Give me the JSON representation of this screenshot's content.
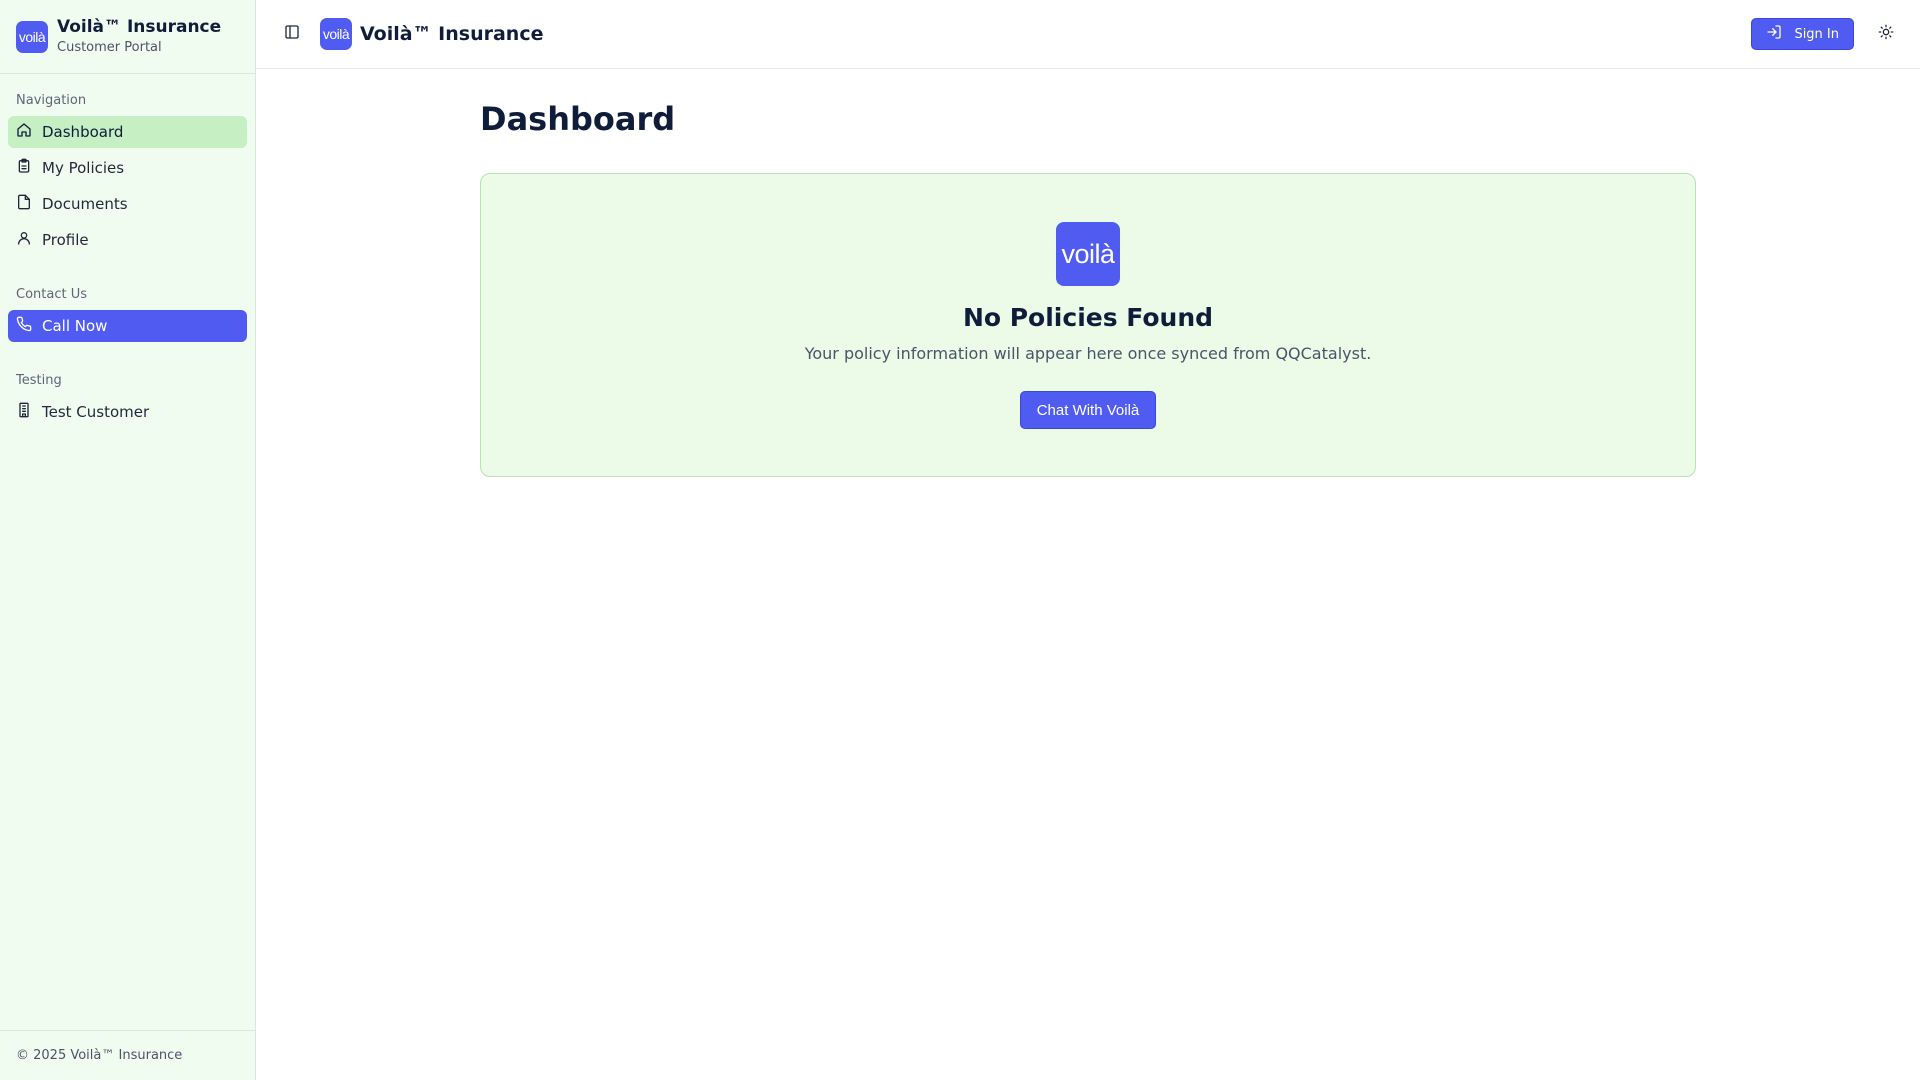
{
  "brand": {
    "logo_text": "voilà",
    "name": "Voilà™ Insurance",
    "subtitle": "Customer Portal",
    "color": "#4f5bf1"
  },
  "sidebar": {
    "groups": [
      {
        "label": "Navigation",
        "items": [
          {
            "label": "Dashboard",
            "icon": "home-icon",
            "active": true
          },
          {
            "label": "My Policies",
            "icon": "clipboard-icon"
          },
          {
            "label": "Documents",
            "icon": "file-icon"
          },
          {
            "label": "Profile",
            "icon": "user-icon"
          }
        ]
      },
      {
        "label": "Contact Us",
        "items": [
          {
            "label": "Call Now",
            "icon": "phone-icon",
            "primary": true
          }
        ]
      },
      {
        "label": "Testing",
        "items": [
          {
            "label": "Test Customer",
            "icon": "building-icon"
          }
        ]
      }
    ],
    "footer": "© 2025 Voilà™ Insurance"
  },
  "topbar": {
    "title": "Voilà™ Insurance",
    "signin_label": "Sign In"
  },
  "main": {
    "page_title": "Dashboard",
    "empty_state": {
      "title": "No Policies Found",
      "text": "Your policy information will appear here once synced from QQCatalyst.",
      "button_label": "Chat With Voilà"
    }
  },
  "colors": {
    "sidebar_bg": "#f1fcf0",
    "active_item_bg": "#c6efc3",
    "card_bg": "#ebfbe8",
    "primary": "#4f5bf1"
  }
}
